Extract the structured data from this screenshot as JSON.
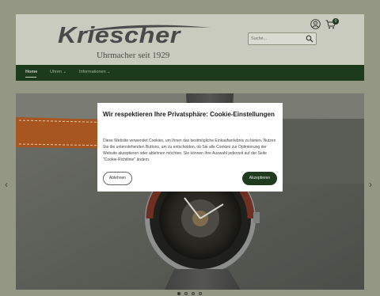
{
  "brand": {
    "name": "Kriescher",
    "tagline": "Uhrmacher seit 1929"
  },
  "search": {
    "placeholder": "Suche..."
  },
  "cart": {
    "count": "0"
  },
  "nav": {
    "home": "Home",
    "uhren": "Uhren ⌄",
    "informationen": "Informationen ⌄"
  },
  "carousel": {
    "prev": "‹",
    "next": "›",
    "slides": 4,
    "active_index": 0
  },
  "cookie_modal": {
    "title": "Wir respektieren Ihre Privatsphäre: Cookie-Einstellungen",
    "text": "Diese Website verwendet Cookies, um Ihnen das bestmögliche Einkaufserlebnis zu bieten. Nutzen Sie die untenstehenden Buttons, um zu entscheiden, ob Sie alle Cookies zur Optimierung der Website akzeptieren oder ablehnen möchten. Sie können Ihre Auswahl jederzeit auf der Seite \"Cookie-Richtlinie\" ändern.",
    "decline_label": "Ablehnen",
    "accept_label": "Akzeptieren"
  },
  "colors": {
    "nav_bg": "#1c3a1c",
    "accept_bg": "#1f3a1f"
  }
}
